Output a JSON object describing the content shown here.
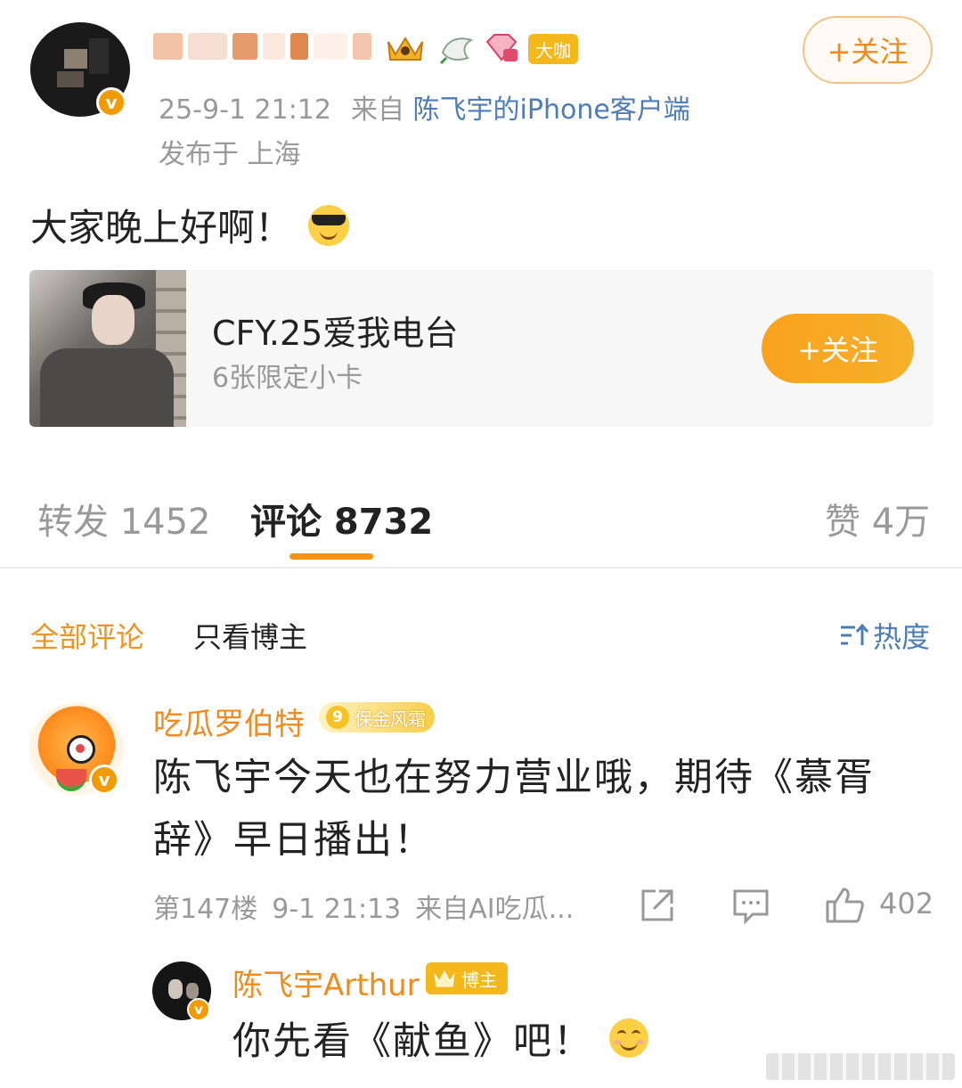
{
  "post": {
    "date": "25-9-1 21:12",
    "source_prefix": "来自",
    "source": "陈飞宇的iPhone客户端",
    "location": "发布于 上海",
    "follow_label": "+关注",
    "vip_badge": "大咖",
    "text": "大家晚上好啊！",
    "emoji_icon": "cool-sunglasses-emoji"
  },
  "card": {
    "title": "CFY.25爱我电台",
    "subtitle": "6张限定小卡",
    "follow_label": "+关注"
  },
  "tabs": [
    {
      "label": "转发 1452"
    },
    {
      "label": "评论 8732"
    },
    {
      "label": "赞 4万"
    }
  ],
  "filters": {
    "all": "全部评论",
    "owner_only": "只看博主",
    "sort": "热度"
  },
  "comment": {
    "username": "吃瓜罗伯特",
    "level": "9",
    "badge": "保金风霜",
    "text": "陈飞宇今天也在努力营业哦，期待《慕胥辞》早日播出！",
    "floor": "第147楼",
    "time": "9-1 21:13",
    "source": "来自AI吃瓜...",
    "likes": "402"
  },
  "reply": {
    "username": "陈飞宇Arthur",
    "badge": "博主",
    "text": "你先看《献鱼》吧！",
    "emoji_icon": "smile-emoji"
  },
  "colors": {
    "accent_orange": "#ef8b1e",
    "link_blue": "#4d7cb6",
    "muted_gray": "#999999"
  }
}
